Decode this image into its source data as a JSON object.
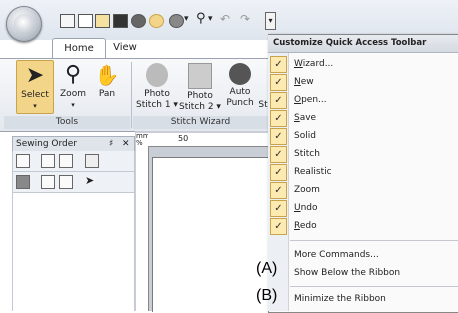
{
  "tabs": {
    "home": "Home",
    "view": "View"
  },
  "ribbon": {
    "buttons": {
      "select": "Select",
      "zoom": "Zoom",
      "pan": "Pan",
      "photo1_line1": "Photo",
      "photo1_line2": "Stitch 1 ▾",
      "photo2_line1": "Photo",
      "photo2_line2": "Stitch 2 ▾",
      "auto_line1": "Auto",
      "auto_line2": "Punch",
      "cut_line2": "St"
    },
    "groups": {
      "tools": "Tools",
      "stitch_wizard": "Stitch Wizard"
    }
  },
  "panel": {
    "title": "Sewing Order",
    "pin": "♯",
    "close": "✕"
  },
  "ruler": {
    "corner_top": "mm",
    "corner_bottom": "%",
    "mark": "50"
  },
  "menu": {
    "title": "Customize Quick Access Toolbar",
    "items": [
      {
        "u": "W",
        "rest": "izard...",
        "checked": "✓"
      },
      {
        "u": "N",
        "rest": "ew",
        "checked": "✓"
      },
      {
        "u": "O",
        "rest": "pen...",
        "checked": "✓"
      },
      {
        "u": "S",
        "rest": "ave",
        "checked": "✓"
      },
      {
        "u": "",
        "rest": "Solid",
        "checked": "✓"
      },
      {
        "u": "",
        "rest": "Stitch",
        "checked": "✓"
      },
      {
        "u": "",
        "rest": "Realistic",
        "checked": "✓"
      },
      {
        "u": "",
        "rest": "Zoom",
        "checked": "✓"
      },
      {
        "u": "U",
        "rest": "ndo",
        "checked": "✓"
      },
      {
        "u": "R",
        "rest": "edo",
        "checked": "✓"
      }
    ],
    "more_commands": "More Commands...",
    "show_below": "Show Below the Ribbon",
    "minimize": "Minimize the Ribbon"
  },
  "callouts": {
    "a": "(A)",
    "b": "(B)"
  }
}
